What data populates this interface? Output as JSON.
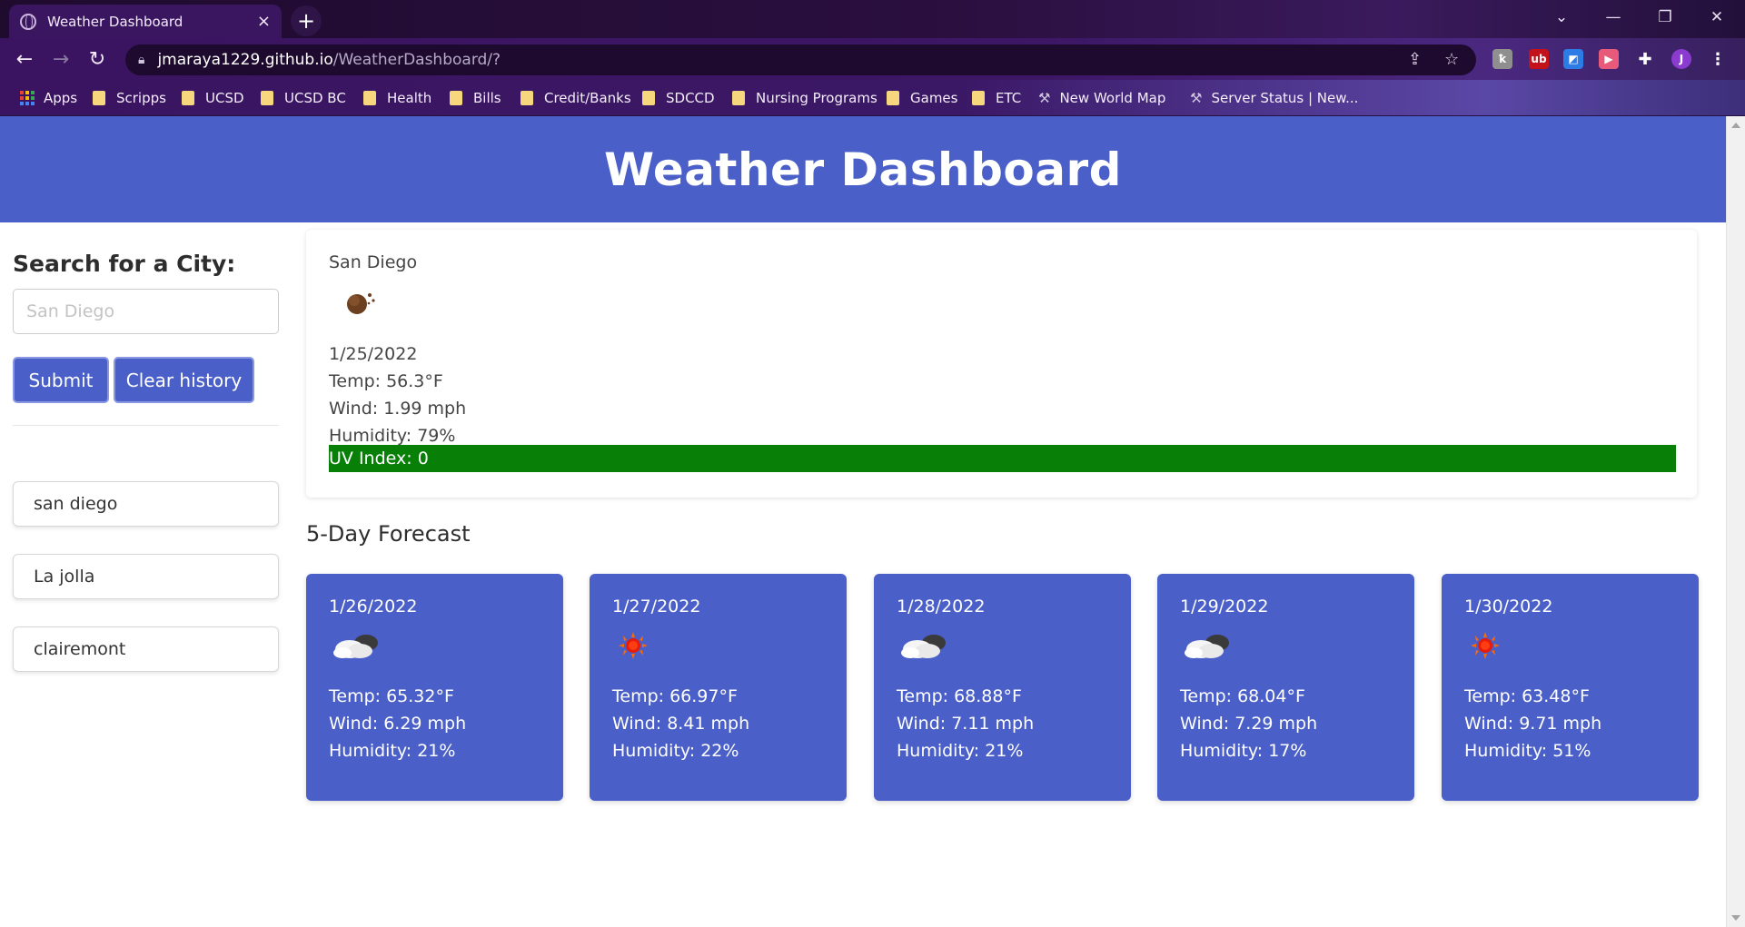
{
  "browser": {
    "tab_title": "Weather Dashboard",
    "tab_close": "×",
    "new_tab": "+",
    "url_host": "jmaraya1229.github.io",
    "url_path": "/WeatherDashboard/?",
    "profile_initial": "J",
    "bookmarks": [
      {
        "label": "Apps",
        "kind": "apps"
      },
      {
        "label": "Scripps",
        "kind": "folder"
      },
      {
        "label": "UCSD",
        "kind": "folder"
      },
      {
        "label": "UCSD BC",
        "kind": "folder"
      },
      {
        "label": "Health",
        "kind": "folder"
      },
      {
        "label": "Bills",
        "kind": "folder"
      },
      {
        "label": "Credit/Banks",
        "kind": "folder"
      },
      {
        "label": "SDCCD",
        "kind": "folder"
      },
      {
        "label": "Nursing Programs",
        "kind": "folder"
      },
      {
        "label": "Games",
        "kind": "folder"
      },
      {
        "label": "ETC",
        "kind": "folder"
      },
      {
        "label": "New World Map",
        "kind": "pickaxe"
      },
      {
        "label": "Server Status | New...",
        "kind": "pickaxe"
      }
    ]
  },
  "header": {
    "title": "Weather Dashboard"
  },
  "sidebar": {
    "heading": "Search for a City:",
    "search_placeholder": "San Diego",
    "submit_label": "Submit",
    "clear_label": "Clear history",
    "history": [
      "san diego",
      "La jolla",
      "clairemont"
    ]
  },
  "current": {
    "city": "San Diego",
    "icon": "night-few-clouds-icon",
    "date": "1/25/2022",
    "temp": "Temp: 56.3°F",
    "wind": "Wind: 1.99 mph",
    "humidity": "Humidity: 79%",
    "uv": "UV Index: 0",
    "uv_color": "#088008"
  },
  "forecast": {
    "title": "5-Day Forecast",
    "card_color": "#4a5fc8",
    "days": [
      {
        "date": "1/26/2022",
        "icon": "partly-cloudy-icon",
        "temp": "Temp: 65.32°F",
        "wind": "Wind: 6.29 mph",
        "humidity": "Humidity: 21%"
      },
      {
        "date": "1/27/2022",
        "icon": "sun-icon",
        "temp": "Temp: 66.97°F",
        "wind": "Wind: 8.41 mph",
        "humidity": "Humidity: 22%"
      },
      {
        "date": "1/28/2022",
        "icon": "partly-cloudy-icon",
        "temp": "Temp: 68.88°F",
        "wind": "Wind: 7.11 mph",
        "humidity": "Humidity: 21%"
      },
      {
        "date": "1/29/2022",
        "icon": "partly-cloudy-icon",
        "temp": "Temp: 68.04°F",
        "wind": "Wind: 7.29 mph",
        "humidity": "Humidity: 17%"
      },
      {
        "date": "1/30/2022",
        "icon": "sun-icon",
        "temp": "Temp: 63.48°F",
        "wind": "Wind: 9.71 mph",
        "humidity": "Humidity: 51%"
      }
    ]
  }
}
